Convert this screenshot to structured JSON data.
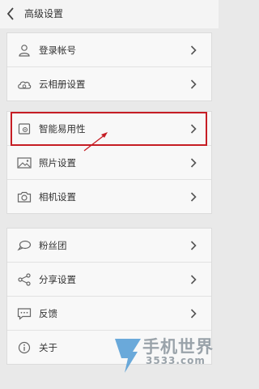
{
  "header": {
    "title": "高级设置"
  },
  "group1": [
    {
      "label": "登录帐号",
      "icon": "user-icon"
    },
    {
      "label": "云相册设置",
      "icon": "cloud-album-icon"
    }
  ],
  "group2": [
    {
      "label": "智能易用性",
      "icon": "smart-settings-icon"
    },
    {
      "label": "照片设置",
      "icon": "photo-icon"
    },
    {
      "label": "相机设置",
      "icon": "camera-icon"
    }
  ],
  "group3": [
    {
      "label": "粉丝团",
      "icon": "chat-bubble-icon"
    },
    {
      "label": "分享设置",
      "icon": "share-icon"
    },
    {
      "label": "反馈",
      "icon": "feedback-icon"
    },
    {
      "label": "关于",
      "icon": "info-icon"
    }
  ],
  "watermark": {
    "brand": "手机世界",
    "site": "3533.com"
  },
  "colors": {
    "highlight": "#c61d24",
    "background": "#e9e9e9",
    "card": "#f8f8f8"
  }
}
